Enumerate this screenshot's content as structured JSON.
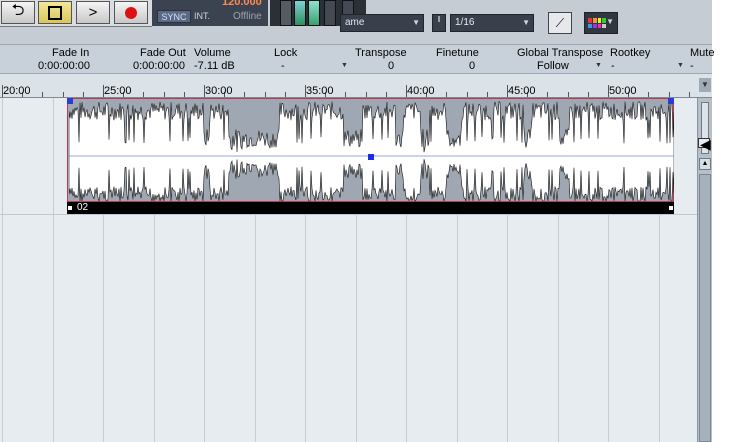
{
  "transport": {
    "cycle_icon": "cycle-icon",
    "stop_icon": "stop-icon",
    "play_icon": "play-icon",
    "record_icon": "record-icon",
    "tempo": "120.000",
    "sync": "SYNC",
    "int": "INT.",
    "offline": "Offline"
  },
  "toolbar": {
    "snap_mode": "ame",
    "quantize": "1/16"
  },
  "info_line": [
    {
      "label": "Fade In",
      "value": "0:00:00:00"
    },
    {
      "label": "Fade Out",
      "value": "0:00:00:00"
    },
    {
      "label": "Volume",
      "value": "-7.11 dB"
    },
    {
      "label": "Lock",
      "value": "-"
    },
    {
      "label": "Transpose",
      "value": "0"
    },
    {
      "label": "Finetune",
      "value": "0"
    },
    {
      "label": "Global Transpose",
      "value": "Follow"
    },
    {
      "label": "Rootkey",
      "value": "-"
    },
    {
      "label": "Mute",
      "value": "-"
    }
  ],
  "ruler": {
    "labels": [
      "20:00",
      "25:00",
      "30:00",
      "35:00",
      "40:00",
      "45:00",
      "50:00"
    ]
  },
  "event": {
    "name": "02"
  },
  "colors": {
    "accent_orange": "#ff8a52",
    "event_border": "#c0374f",
    "waveform_fill": "#ffffff",
    "handle_blue": "#1a2ee6"
  }
}
